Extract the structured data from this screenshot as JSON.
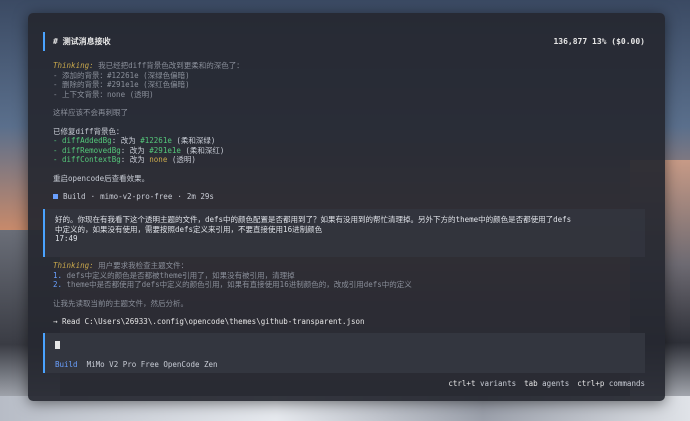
{
  "header": {
    "title": "# 测试消息接收",
    "tokens": "136,877",
    "percent_cost": "13% ($0.00)"
  },
  "thinking1": {
    "label": "Thinking:",
    "text": " 我已经把diff背景色改到更柔和的深色了：",
    "lines": [
      "- 添加的背景：#12261e (深绿色偏暗)",
      "- 删除的背景：#291e1e (深红色偏暗)",
      "- 上下文背景：none (透明)"
    ],
    "after": "这样应该不会再刺眼了"
  },
  "fixed": {
    "heading": "已修复diff背景色：",
    "items": [
      {
        "key": "- diffAddedBg",
        "mid": ": 改为 ",
        "val": "#12261e",
        "note": " (柔和深绿)"
      },
      {
        "key": "- diffRemovedBg",
        "mid": ": 改为 ",
        "val": "#291e1e",
        "note": " (柔和深红)"
      },
      {
        "key": "- diffContextBg",
        "mid": ": 改为 ",
        "val": "none",
        "note": " (透明)"
      }
    ],
    "restart": "重启opencode后查看效果。"
  },
  "build": {
    "label": "Build",
    "model": "mimo-v2-pro-free",
    "duration": "2m 29s"
  },
  "user_message": {
    "line1": "好的。你现在有我看下这个透明主题的文件，defs中的颜色配置是否都用到了？如果有没用到的帮忙清理掉。另外下方的theme中的颜色是否都使用了defs",
    "line2": "中定义的，如果没有使用，需要按照defs定义来引用，不要直接使用16进制颜色",
    "time": "17:49"
  },
  "thinking2": {
    "label": "Thinking:",
    "text": " 用户要求我检查主题文件：",
    "lines": [
      {
        "num": "1.",
        "text": " defs中定义的颜色是否都被theme引用了，如果没有被引用，清理掉"
      },
      {
        "num": "2.",
        "text": " theme中是否都使用了defs中定义的颜色引用，如果有直接使用16进制颜色的，改成引用defs中的定义"
      }
    ],
    "after": "让我先读取当前的主题文件，然后分析。",
    "read": "→ Read C:\\Users\\26933\\.config\\opencode\\themes\\github-transparent.json"
  },
  "input": {
    "mode": "Build",
    "model_name": "MiMo V2 Pro Free",
    "provider": "OpenCode Zen"
  },
  "hints": {
    "variants_key": "ctrl+t",
    "variants_label": "variants",
    "agents_key": "tab",
    "agents_label": "agents",
    "commands_key": "ctrl+p",
    "commands_label": "commands"
  }
}
